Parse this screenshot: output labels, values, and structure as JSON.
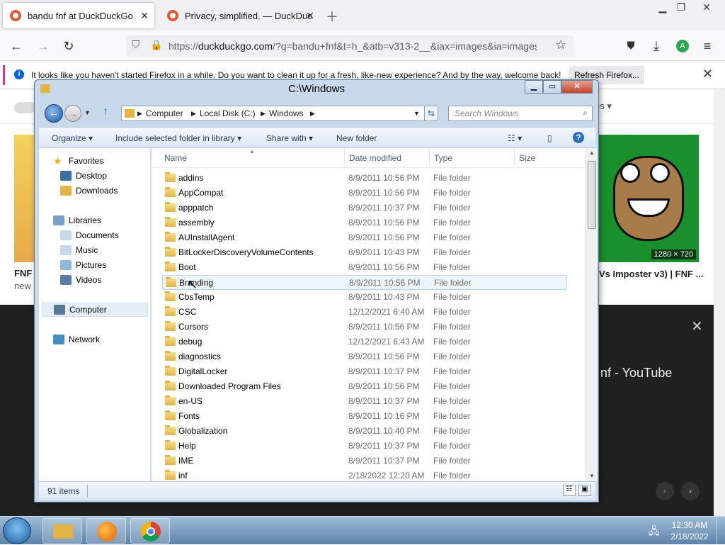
{
  "browser": {
    "tabs": [
      {
        "title": "bandu fnf at DuckDuckGo",
        "active": true
      },
      {
        "title": "Privacy, simplified. — DuckDuc",
        "active": false
      }
    ],
    "url": "https://duckduckgo.com/?q=bandu+fnf&t=h_&atb=v313-2__&iax=images&ia=images&",
    "url_host": "duckduckgo.com",
    "url_rest": "/?q=bandu+fnf&t=h_&atb=v313-2__&iax=images&ia=images&",
    "url_scheme": "https://",
    "profile_initial": "A",
    "infobar": {
      "text": "It looks like you haven't started Firefox in a while. Do you want to clean it up for a fresh, like-new experience? And by the way, welcome back!",
      "button": "Refresh Firefox..."
    },
    "icons": {
      "back": "arrow-left-icon",
      "forward": "arrow-right-icon",
      "reload": "reload-icon",
      "star": "star-icon",
      "pocket": "pocket-icon",
      "download": "download-icon",
      "menu": "hamburger-icon"
    }
  },
  "page_behind": {
    "left_card": {
      "title": "FNF",
      "subtitle": "new"
    },
    "right_card": {
      "size_badge": "1280 × 720",
      "title": "Vs Imposter v3) | FNF ..."
    },
    "panel": {
      "title": "nf - YouTube"
    },
    "filter_label": "es"
  },
  "explorer": {
    "title": "C:\\Windows",
    "breadcrumb": [
      "Computer",
      "Local Disk (C:)",
      "Windows"
    ],
    "search_placeholder": "Search Windows",
    "toolbar": {
      "organize": "Organize",
      "include": "Include selected folder in library",
      "share": "Share with",
      "new_folder": "New folder"
    },
    "nav": {
      "favorites": "Favorites",
      "desktop": "Desktop",
      "downloads": "Downloads",
      "libraries": "Libraries",
      "documents": "Documents",
      "music": "Music",
      "pictures": "Pictures",
      "videos": "Videos",
      "computer": "Computer",
      "network": "Network"
    },
    "columns": {
      "name": "Name",
      "date": "Date modified",
      "type": "Type",
      "size": "Size"
    },
    "files": [
      {
        "name": "addins",
        "date": "8/9/2011 10:56 PM",
        "type": "File folder"
      },
      {
        "name": "AppCompat",
        "date": "8/9/2011 10:56 PM",
        "type": "File folder"
      },
      {
        "name": "apppatch",
        "date": "8/9/2011 10:37 PM",
        "type": "File folder"
      },
      {
        "name": "assembly",
        "date": "8/9/2011 10:56 PM",
        "type": "File folder"
      },
      {
        "name": "AUInstallAgent",
        "date": "8/9/2011 10:56 PM",
        "type": "File folder"
      },
      {
        "name": "BitLockerDiscoveryVolumeContents",
        "date": "8/9/2011 10:43 PM",
        "type": "File folder"
      },
      {
        "name": "Boot",
        "date": "8/9/2011 10:56 PM",
        "type": "File folder"
      },
      {
        "name": "Branding",
        "date": "8/9/2011 10:56 PM",
        "type": "File folder"
      },
      {
        "name": "CbsTemp",
        "date": "8/9/2011 10:43 PM",
        "type": "File folder"
      },
      {
        "name": "CSC",
        "date": "12/12/2021 6:40 AM",
        "type": "File folder"
      },
      {
        "name": "Cursors",
        "date": "8/9/2011 10:56 PM",
        "type": "File folder"
      },
      {
        "name": "debug",
        "date": "12/12/2021 6:43 AM",
        "type": "File folder"
      },
      {
        "name": "diagnostics",
        "date": "8/9/2011 10:56 PM",
        "type": "File folder"
      },
      {
        "name": "DigitalLocker",
        "date": "8/9/2011 10:37 PM",
        "type": "File folder"
      },
      {
        "name": "Downloaded Program Files",
        "date": "8/9/2011 10:56 PM",
        "type": "File folder"
      },
      {
        "name": "en-US",
        "date": "8/9/2011 10:37 PM",
        "type": "File folder"
      },
      {
        "name": "Fonts",
        "date": "8/9/2011 10:16 PM",
        "type": "File folder"
      },
      {
        "name": "Globalization",
        "date": "8/9/2011 10:40 PM",
        "type": "File folder"
      },
      {
        "name": "Help",
        "date": "8/9/2011 10:37 PM",
        "type": "File folder"
      },
      {
        "name": "IME",
        "date": "8/9/2011 10:37 PM",
        "type": "File folder"
      },
      {
        "name": "inf",
        "date": "2/18/2022 12:20 AM",
        "type": "File folder"
      }
    ],
    "selected_index": 7,
    "status": "91 items"
  },
  "taskbar": {
    "time": "12:30 AM",
    "date": "2/18/2022"
  },
  "colors": {
    "firefox_accent": "#0060df",
    "infobar_stripe": "#cb3aa0",
    "duckduckgo": "#de5833",
    "taskbar": "#5d82a8"
  }
}
